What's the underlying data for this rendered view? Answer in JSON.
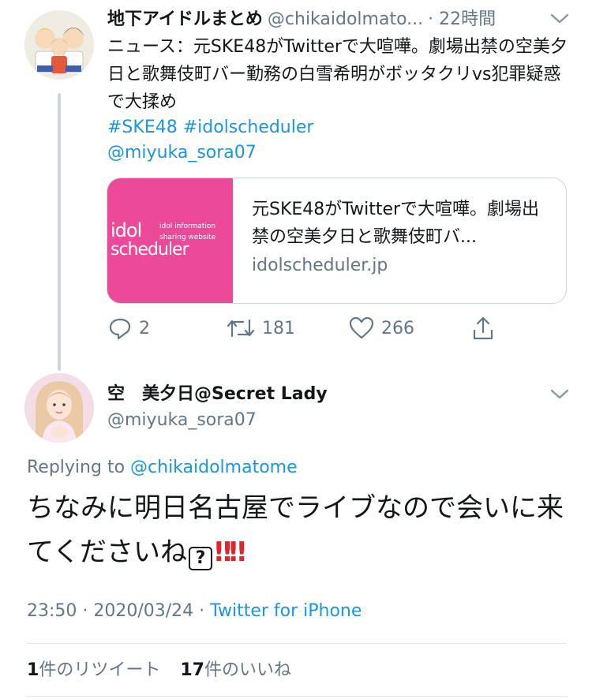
{
  "tweet1": {
    "author_name": "地下アイドルまとめ",
    "author_handle": "@chikaidolmato...",
    "time": "· 22時間",
    "text": "ニュース：元SKE48がTwitterで大喧嘩。劇場出禁の空美夕日と歌舞伎町バー勤務の白雪希明がボッタクリvs犯罪疑惑で大揉め",
    "hashtags": "#SKE48 #idolscheduler",
    "mention": "@miyuka_sora07",
    "card": {
      "title": "元SKE48がTwitterで大喧嘩。劇場出禁の空美夕日と歌舞伎町バ...",
      "domain": "idolscheduler.jp",
      "thumb": {
        "line1": "idol information",
        "line2": "sharing website",
        "word1": "idol",
        "word2": "scheduler",
        "bg_color": "#ec4a98"
      }
    },
    "actions": {
      "replies": "2",
      "retweets": "181",
      "likes": "266"
    }
  },
  "tweet2": {
    "author_name": "空　美夕日@Secret Lady",
    "author_handle": "@miyuka_sora07",
    "replying_prefix": "Replying to",
    "replying_to": "@chikaidolmatome",
    "text": "ちなみに明日名古屋でライブなので会いに来てくださいね",
    "emoji_box": "?",
    "emoji_bangs": "‼‼",
    "timestamp": "23:50 · 2020/03/24 ·",
    "source": "Twitter for iPhone",
    "retweets_count": "1",
    "retweets_label": "件のリツイート",
    "likes_count": "17",
    "likes_label": "件のいいね"
  },
  "icons": [
    "chevron-down-icon",
    "reply-icon",
    "retweet-icon",
    "like-icon",
    "share-icon"
  ],
  "colors": {
    "link": "#1b95e0",
    "secondary": "#657786",
    "text": "#14171a",
    "thread_line": "#ccd6dd",
    "alert_red": "#e0242b"
  }
}
